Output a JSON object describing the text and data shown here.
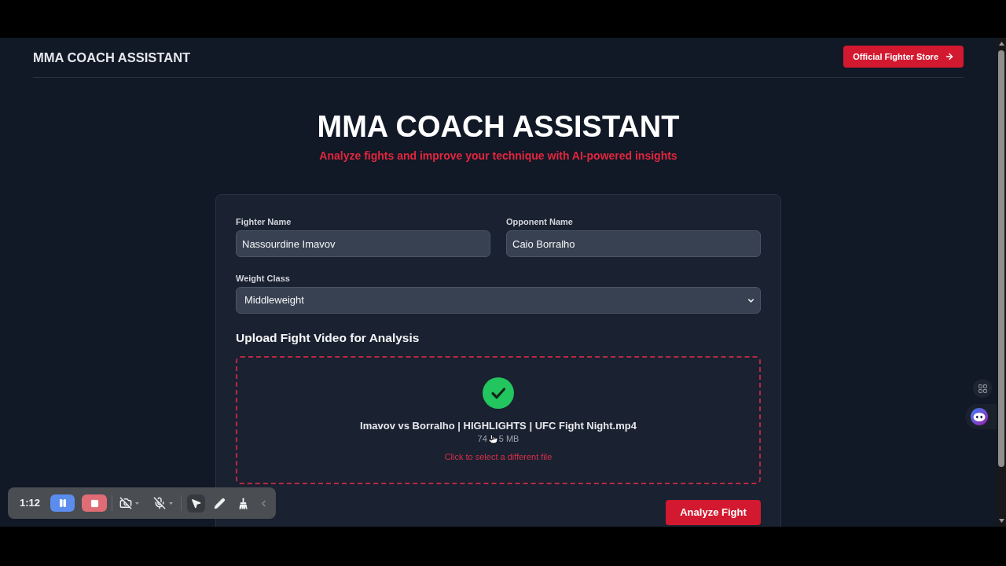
{
  "header": {
    "brand": "MMA COACH ASSISTANT",
    "store_button": {
      "label": "Official Fighter Store"
    }
  },
  "hero": {
    "title": "MMA COACH ASSISTANT",
    "subtitle": "Analyze fights and improve your technique with AI-powered insights"
  },
  "form": {
    "fields": [
      {
        "kind": "text",
        "label": "Fighter Name",
        "value": "Nassourdine Imavov"
      },
      {
        "kind": "text",
        "label": "Opponent Name",
        "value": "Caio Borralho"
      },
      {
        "kind": "select",
        "label": "Weight Class",
        "value": "Middleweight"
      }
    ],
    "upload": {
      "heading": "Upload Fight Video for Analysis",
      "uploaded": true,
      "file_name": "Imavov vs Borralho | HIGHLIGHTS | UFC Fight Night.mp4",
      "file_size_parts": [
        "74",
        "5 MB"
      ],
      "hint": "Click to select a different file"
    },
    "submit_button": {
      "label": "Analyze Fight"
    }
  },
  "recorder_toolbar": {
    "time": "1:12",
    "camera_on": false,
    "mic_on": false,
    "tools": [
      {
        "kind": "pointer",
        "selected": true
      },
      {
        "kind": "pencil",
        "selected": false
      },
      {
        "kind": "broom",
        "selected": false
      }
    ]
  }
}
